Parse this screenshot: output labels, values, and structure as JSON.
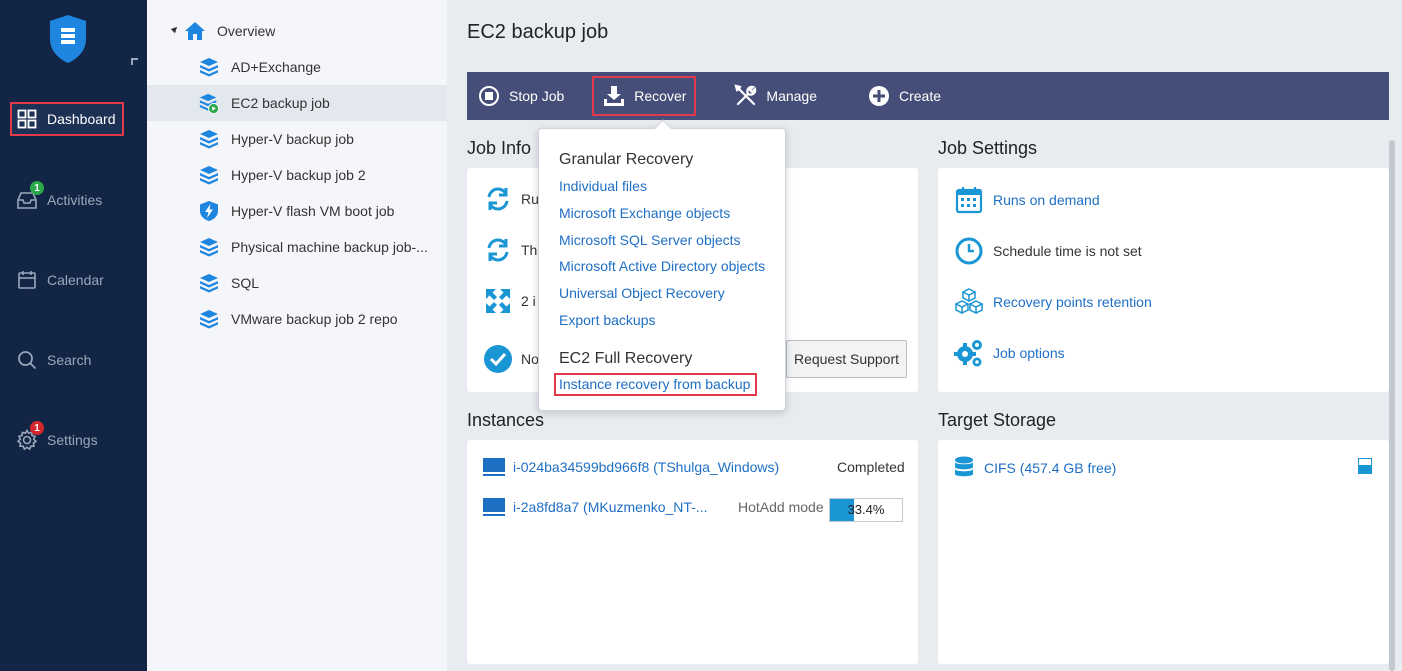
{
  "nav": {
    "items": [
      {
        "key": "dashboard",
        "label": "Dashboard",
        "icon": "grid-icon",
        "active": true
      },
      {
        "key": "activities",
        "label": "Activities",
        "icon": "inbox-icon",
        "badge": "1"
      },
      {
        "key": "calendar",
        "label": "Calendar",
        "icon": "calendar-icon"
      },
      {
        "key": "search",
        "label": "Search",
        "icon": "search-icon"
      },
      {
        "key": "settings",
        "label": "Settings",
        "icon": "gear-icon",
        "badge": "1"
      }
    ]
  },
  "tree": {
    "root": "Overview",
    "items": [
      {
        "label": "AD+Exchange",
        "icon": "job-stack-icon"
      },
      {
        "label": "EC2 backup job",
        "icon": "job-running-icon",
        "selected": true
      },
      {
        "label": "Hyper-V backup job",
        "icon": "job-stack-icon"
      },
      {
        "label": "Hyper-V backup job 2",
        "icon": "job-stack-icon"
      },
      {
        "label": "Hyper-V flash VM boot job",
        "icon": "flash-boot-icon"
      },
      {
        "label": "Physical machine backup job-...",
        "icon": "job-stack-icon"
      },
      {
        "label": "SQL",
        "icon": "job-stack-icon"
      },
      {
        "label": "VMware backup job 2 repo",
        "icon": "job-stack-icon"
      }
    ]
  },
  "page": {
    "title": "EC2 backup job"
  },
  "toolbar": {
    "stop_label": "Stop Job",
    "recover_label": "Recover",
    "manage_label": "Manage",
    "create_label": "Create"
  },
  "job_info": {
    "title": "Job Info",
    "rows": [
      "Ru",
      "Th",
      "2 i",
      "No"
    ],
    "request_support": "Request Support"
  },
  "job_settings": {
    "title": "Job Settings",
    "runs": "Runs on demand",
    "schedule": "Schedule time is not set",
    "retention": "Recovery points retention",
    "options": "Job options"
  },
  "instances": {
    "title": "Instances",
    "rows": [
      {
        "name": "i-024ba34599bd966f8 (TShulga_Windows)",
        "status": "Completed"
      },
      {
        "name": "i-2a8fd8a7 (MKuzmenko_NT-...",
        "status": "HotAdd mode",
        "progress": 0.334,
        "progress_text": "33.4%"
      }
    ]
  },
  "target_storage": {
    "title": "Target Storage",
    "name": "CIFS (457.4 GB free)",
    "usage": 0.6
  },
  "dropdown": {
    "granular_title": "Granular Recovery",
    "items": [
      "Individual files",
      "Microsoft Exchange objects",
      "Microsoft SQL Server objects",
      "Microsoft Active Directory objects",
      "Universal Object Recovery",
      "Export backups"
    ],
    "full_title": "EC2 Full Recovery",
    "full_item": "Instance recovery from backup"
  },
  "colors": {
    "nav_bg": "#132544",
    "toolbar_bg": "#454e78",
    "link": "#1f6fc5",
    "highlight": "#e23a4a",
    "accent": "#1a96d4"
  }
}
